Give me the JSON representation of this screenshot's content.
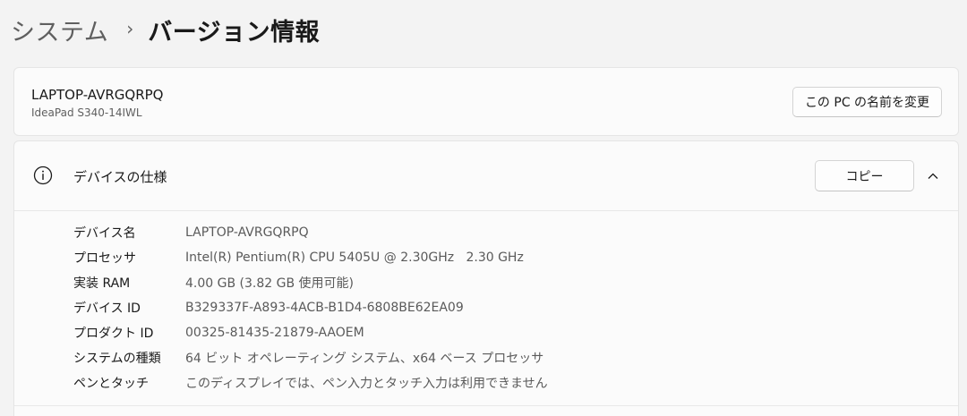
{
  "breadcrumb": {
    "parent": "システム",
    "separator": "›",
    "current": "バージョン情報"
  },
  "device": {
    "name": "LAPTOP-AVRGQRPQ",
    "model": "IdeaPad S340-14IWL",
    "rename_button": "この PC の名前を変更"
  },
  "specs": {
    "title": "デバイスの仕様",
    "copy_button": "コピー",
    "icon": "info-icon",
    "collapse_icon": "chevron-up-icon",
    "rows": [
      {
        "label": "デバイス名",
        "value": "LAPTOP-AVRGQRPQ"
      },
      {
        "label": "プロセッサ",
        "value": "Intel(R) Pentium(R) CPU 5405U @ 2.30GHz   2.30 GHz"
      },
      {
        "label": "実装 RAM",
        "value": "4.00 GB (3.82 GB 使用可能)"
      },
      {
        "label": "デバイス ID",
        "value": "B329337F-A893-4ACB-B1D4-6808BE62EA09"
      },
      {
        "label": "プロダクト ID",
        "value": "00325-81435-21879-AAOEM"
      },
      {
        "label": "システムの種類",
        "value": "64 ビット オペレーティング システム、x64 ベース プロセッサ"
      },
      {
        "label": "ペンとタッチ",
        "value": "このディスプレイでは、ペン入力とタッチ入力は利用できません"
      }
    ]
  },
  "colors": {
    "background": "#f3f3f3",
    "card": "#fbfbfb",
    "border": "#e5e5e5",
    "secondary_text": "#5f5f5f"
  }
}
